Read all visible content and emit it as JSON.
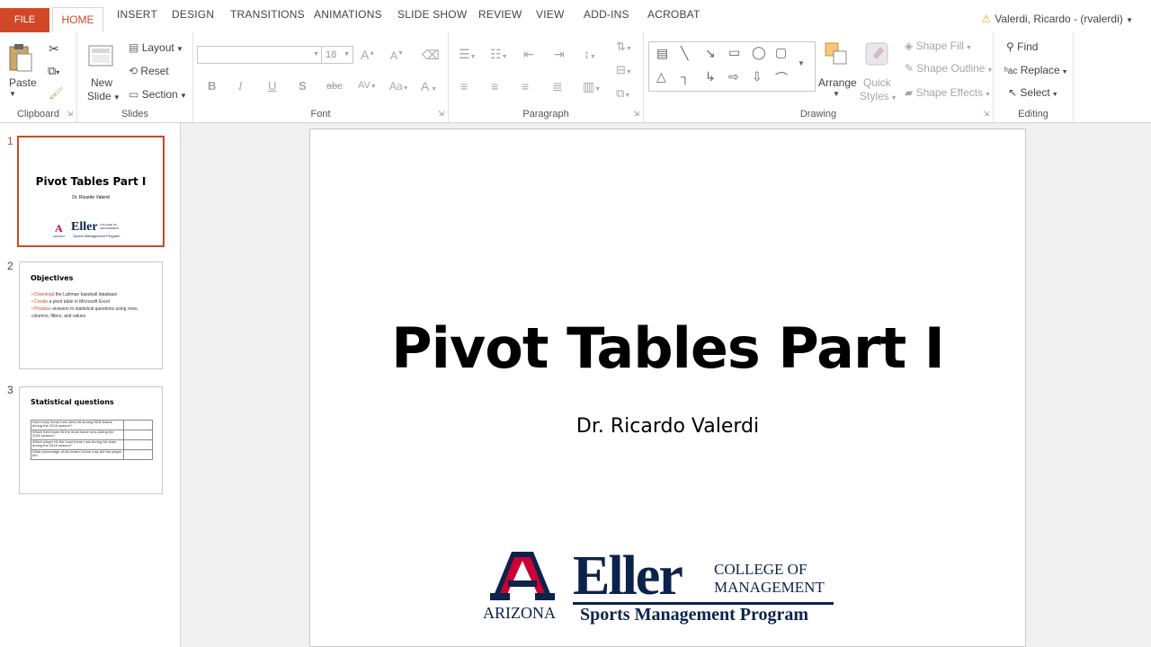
{
  "tabs": [
    "FILE",
    "HOME",
    "INSERT",
    "DESIGN",
    "TRANSITIONS",
    "ANIMATIONS",
    "SLIDE SHOW",
    "REVIEW",
    "VIEW",
    "ADD-INS",
    "ACROBAT"
  ],
  "active_tab": "HOME",
  "user": "Valerdi, Ricardo - (rvalerdi)",
  "ribbon": {
    "clipboard": {
      "label": "Clipboard",
      "paste": "Paste"
    },
    "slides": {
      "label": "Slides",
      "new_slide_1": "New",
      "new_slide_2": "Slide",
      "layout": "Layout",
      "reset": "Reset",
      "section": "Section"
    },
    "font": {
      "label": "Font",
      "size": "18",
      "b": "B",
      "i": "I",
      "u": "U",
      "s": "S",
      "abc": "abc",
      "av": "AV",
      "aa": "Aa",
      "a": "A"
    },
    "paragraph": {
      "label": "Paragraph"
    },
    "drawing": {
      "label": "Drawing",
      "arrange": "Arrange",
      "quick_styles_1": "Quick",
      "quick_styles_2": "Styles",
      "shape_fill": "Shape Fill",
      "shape_outline": "Shape Outline",
      "shape_effects": "Shape Effects"
    },
    "editing": {
      "label": "Editing",
      "find": "Find",
      "replace": "Replace",
      "select": "Select"
    }
  },
  "slides": [
    {
      "num": "1",
      "title": "Pivot Tables Part I",
      "subtitle": "Dr. Ricardo Valerdi"
    },
    {
      "num": "2",
      "title": "Objectives",
      "bullets": [
        {
          "verb": "Download",
          "rest": " the Lahman baseball database"
        },
        {
          "verb": "Create",
          "rest": " a pivot table in Microsoft Excel"
        },
        {
          "verb": "Produce",
          "rest": " answers to statistical questions using rows, columns, filters, and values"
        }
      ]
    },
    {
      "num": "3",
      "title": "Statistical questions",
      "rows": [
        "How many home runs were hit among MLB teams during the 2016 season?",
        "Which third base hit the most home runs during the 2016 season?",
        "Which player hit the most home runs during his team during the 2016 season?",
        "What percentage of his team's home runs did the player hit?"
      ]
    }
  ],
  "main_slide": {
    "title": "Pivot Tables Part I",
    "subtitle": "Dr. Ricardo Valerdi"
  },
  "logo": {
    "eller": "Eller",
    "college_1": "COLLEGE OF",
    "college_2": "MANAGEMENT",
    "program": "Sports Management Program",
    "az": "ARIZONA",
    "az_letter": "A",
    "mini_eller": "Eller",
    "mini_college": "COLLEGE OF MANAGEMENT",
    "mini_program": "Sports Management Program",
    "mini_az": "ARIZONA"
  },
  "colors": {
    "accent": "#d24726",
    "navy": "#0c234b",
    "red": "#cc0033"
  }
}
